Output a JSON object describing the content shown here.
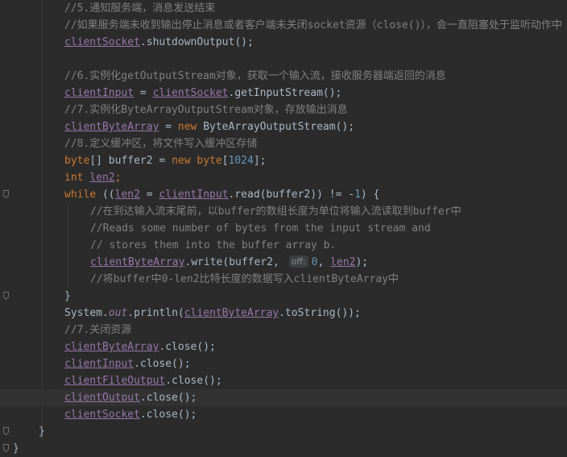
{
  "editor": {
    "lines": [
      {
        "segments": [
          {
            "cls": "c",
            "text": "//5.通知服务端，消息发送结束"
          }
        ],
        "indent": 1
      },
      {
        "segments": [
          {
            "cls": "c",
            "text": "//如果服务端未收到输出停止消息或者客户端未关闭socket资源（close()），会一直阻塞处于监听动作中"
          }
        ],
        "indent": 1
      },
      {
        "segments": [
          {
            "cls": "f",
            "text": "clientSocket"
          },
          {
            "cls": "p",
            "text": ".shutdownOutput();"
          }
        ],
        "indent": 1
      },
      {
        "segments": [],
        "indent": 1
      },
      {
        "segments": [
          {
            "cls": "c",
            "text": "//6.实例化getOutputStream对象，获取一个输入流，接收服务器端返回的消息"
          }
        ],
        "indent": 1
      },
      {
        "segments": [
          {
            "cls": "f",
            "text": "clientInput"
          },
          {
            "cls": "p",
            "text": " = "
          },
          {
            "cls": "f",
            "text": "clientSocket"
          },
          {
            "cls": "p",
            "text": ".getInputStream();"
          }
        ],
        "indent": 1
      },
      {
        "segments": [
          {
            "cls": "c",
            "text": "//7.实例化ByteArrayOutputStream对象，存放输出消息"
          }
        ],
        "indent": 1
      },
      {
        "segments": [
          {
            "cls": "f",
            "text": "clientByteArray"
          },
          {
            "cls": "p",
            "text": " = "
          },
          {
            "cls": "k",
            "text": "new "
          },
          {
            "cls": "p",
            "text": "ByteArrayOutputStream();"
          }
        ],
        "indent": 1
      },
      {
        "segments": [
          {
            "cls": "c",
            "text": "//8.定义缓冲区，将文件写入缓冲区存储"
          }
        ],
        "indent": 1
      },
      {
        "segments": [
          {
            "cls": "k",
            "text": "byte"
          },
          {
            "cls": "p",
            "text": "[] buffer2 = "
          },
          {
            "cls": "k",
            "text": "new byte"
          },
          {
            "cls": "p",
            "text": "["
          },
          {
            "cls": "n",
            "text": "1024"
          },
          {
            "cls": "p",
            "text": "];"
          }
        ],
        "indent": 1
      },
      {
        "segments": [
          {
            "cls": "k",
            "text": "int "
          },
          {
            "cls": "f",
            "text": "len2"
          },
          {
            "cls": "k",
            "text": ";"
          }
        ],
        "indent": 1
      },
      {
        "segments": [
          {
            "cls": "k",
            "text": "while "
          },
          {
            "cls": "p",
            "text": "(("
          },
          {
            "cls": "f",
            "text": "len2"
          },
          {
            "cls": "p",
            "text": " = "
          },
          {
            "cls": "f",
            "text": "clientInput"
          },
          {
            "cls": "p",
            "text": ".read(buffer2)) != -"
          },
          {
            "cls": "n",
            "text": "1"
          },
          {
            "cls": "p",
            "text": ") {"
          }
        ],
        "indent": 1,
        "fold": true
      },
      {
        "segments": [
          {
            "cls": "c",
            "text": "//在到达输入流末尾前，以buffer的数组长度为单位将输入流读取到buffer中"
          }
        ],
        "indent": 2
      },
      {
        "segments": [
          {
            "cls": "c",
            "text": "//Reads some number of bytes from the input stream and"
          }
        ],
        "indent": 2
      },
      {
        "segments": [
          {
            "cls": "c",
            "text": "// stores them into the buffer array b."
          }
        ],
        "indent": 2
      },
      {
        "segments": [
          {
            "cls": "f",
            "text": "clientByteArray"
          },
          {
            "cls": "p",
            "text": ".write(buffer2, "
          },
          {
            "cls": "hint",
            "text": "off:"
          },
          {
            "cls": "n",
            "text": "0"
          },
          {
            "cls": "p",
            "text": ", "
          },
          {
            "cls": "f",
            "text": "len2"
          },
          {
            "cls": "p",
            "text": ");"
          }
        ],
        "indent": 2
      },
      {
        "segments": [
          {
            "cls": "c",
            "text": "//将buffer中0-len2比特长度的数据写入clientByteArray中"
          }
        ],
        "indent": 2
      },
      {
        "segments": [
          {
            "cls": "p",
            "text": "}"
          }
        ],
        "indent": 1,
        "fold": true
      },
      {
        "segments": [
          {
            "cls": "p",
            "text": "System."
          },
          {
            "cls": "fn",
            "text": "out"
          },
          {
            "cls": "p",
            "text": ".println("
          },
          {
            "cls": "f",
            "text": "clientByteArray"
          },
          {
            "cls": "p",
            "text": ".toString());"
          }
        ],
        "indent": 1
      },
      {
        "segments": [
          {
            "cls": "c",
            "text": "//7.关闭资源"
          }
        ],
        "indent": 1
      },
      {
        "segments": [
          {
            "cls": "f",
            "text": "clientByteArray"
          },
          {
            "cls": "p",
            "text": ".close();"
          }
        ],
        "indent": 1
      },
      {
        "segments": [
          {
            "cls": "f",
            "text": "clientInput"
          },
          {
            "cls": "p",
            "text": ".close();"
          }
        ],
        "indent": 1
      },
      {
        "segments": [
          {
            "cls": "f",
            "text": "clientFileOutput"
          },
          {
            "cls": "p",
            "text": ".close();"
          }
        ],
        "indent": 1
      },
      {
        "segments": [
          {
            "cls": "f",
            "text": "clientOutput"
          },
          {
            "cls": "p",
            "text": ".close();"
          }
        ],
        "indent": 1,
        "current": true
      },
      {
        "segments": [
          {
            "cls": "f",
            "text": "clientSocket"
          },
          {
            "cls": "p",
            "text": ".close();"
          }
        ],
        "indent": 1
      },
      {
        "segments": [
          {
            "cls": "p",
            "text": "}"
          }
        ],
        "indent": 0,
        "fold": true
      },
      {
        "segments": [
          {
            "cls": "p",
            "text": "}"
          }
        ],
        "indent": -1,
        "fold": true
      }
    ]
  }
}
